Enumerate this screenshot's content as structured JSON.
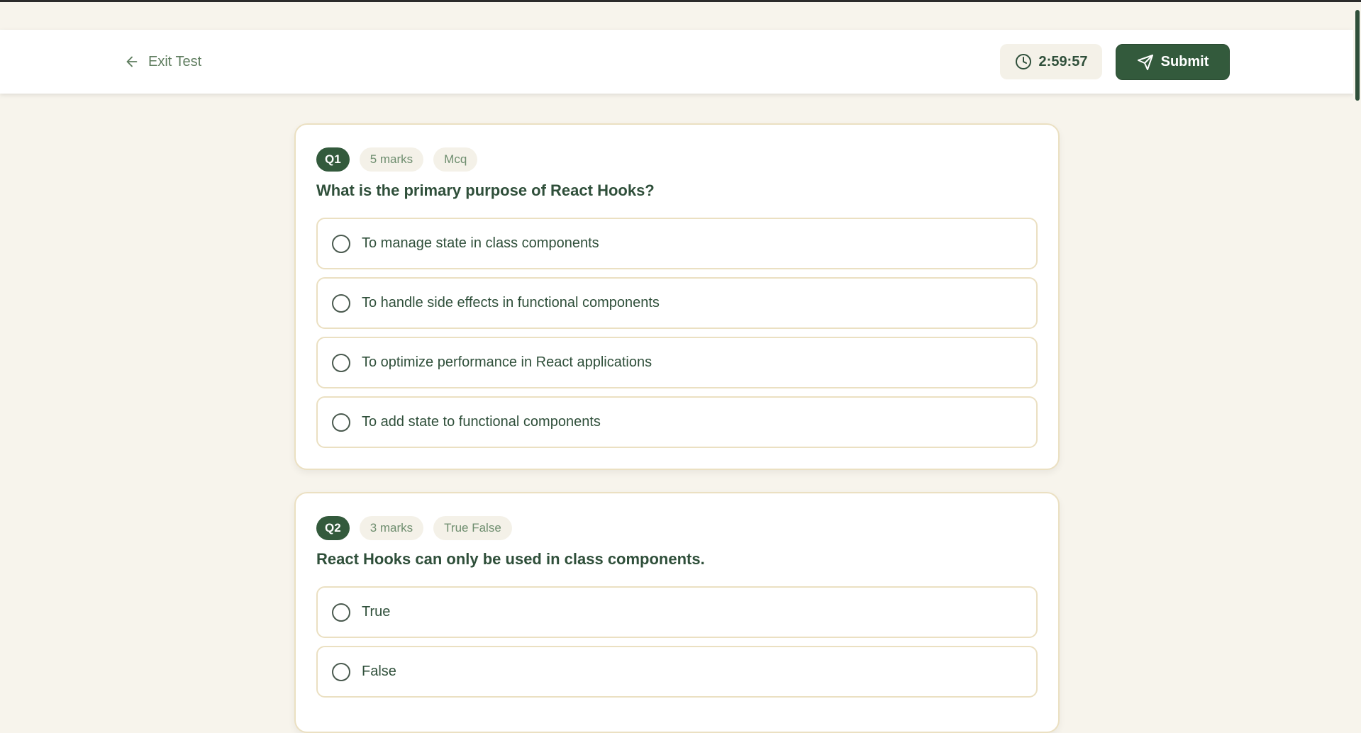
{
  "header": {
    "exit_label": "Exit Test",
    "timer": "2:59:57",
    "submit_label": "Submit"
  },
  "questions": [
    {
      "number": "Q1",
      "marks": "5 marks",
      "type": "Mcq",
      "text": "What is the primary purpose of React Hooks?",
      "options": [
        "To manage state in class components",
        "To handle side effects in functional components",
        "To optimize performance in React applications",
        "To add state to functional components"
      ]
    },
    {
      "number": "Q2",
      "marks": "3 marks",
      "type": "True False",
      "text": "React Hooks can only be used in class components.",
      "options": [
        "True",
        "False"
      ]
    }
  ],
  "colors": {
    "background": "#f7f4ec",
    "accent": "#335a3c",
    "border": "#ebe0c2"
  }
}
